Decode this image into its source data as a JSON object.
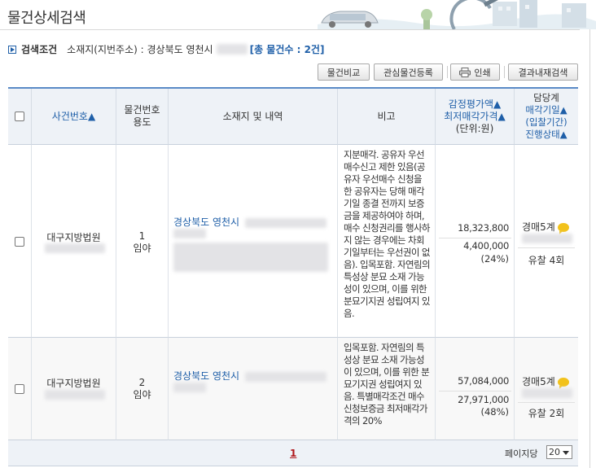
{
  "page": {
    "title": "물건상세검색"
  },
  "condition": {
    "label": "검색조건",
    "location": "소재지(지번주소) : 경상북도 영천시",
    "total": "[총 물건수 : 2건]"
  },
  "toolbar": {
    "compare": "물건비교",
    "register": "관심물건등록",
    "print": "인쇄",
    "search_in_results": "결과내재검색"
  },
  "table": {
    "headers": {
      "case_no": "사건번호",
      "item_no": "물건번호",
      "usage": "용도",
      "location": "소재지 및 내역",
      "note": "비고",
      "appraisal": "감정평가액",
      "min_price": "최저매각가격",
      "unit": "(단위:원)",
      "dept": "담당계",
      "sale_date": "매각기일",
      "period": "(입찰기간)",
      "status": "진행상태"
    },
    "sort_arrow": "▲",
    "rows": [
      {
        "court": "대구지방법원",
        "item_no": "1",
        "usage": "임야",
        "address": "경상북도 영천시",
        "note": "지분매각. 공유자 우선매수신고 제한 있음(공유자 우선매수 신청을 한 공유자는 당해 매각기일 종결 전까지 보증금을 제공하여야 하며, 매수 신청권리를 행사하지 않는 경우에는 차회 기일부터는 우선권이 없음). 입목포함. 자연림의 특성상 분묘 소재 가능성이 있으며, 이를 위한 분묘기지권 성립여지 있음.",
        "appraisal": "18,323,800",
        "min_price": "4,400,000",
        "min_pct": "(24%)",
        "dept": "경매5계",
        "status": "유찰 4회"
      },
      {
        "court": "대구지방법원",
        "item_no": "2",
        "usage": "임야",
        "address": "경상북도 영천시",
        "note": "입목포함. 자연림의 특성상 분묘 소재 가능성이 있으며, 이를 위한 분묘기지권 성립여지 있음. 특별매각조건 매수신청보증금 최저매각가격의 20%",
        "appraisal": "57,084,000",
        "min_price": "27,971,000",
        "min_pct": "(48%)",
        "dept": "경매5계",
        "status": "유찰 2회"
      }
    ]
  },
  "pagination": {
    "current_page": "1",
    "per_page_label": "페이지당",
    "per_page_value": "20"
  },
  "colors": {
    "accent_blue": "#1f5fa8",
    "header_bg": "#eef2f7",
    "page_red": "#b0181d",
    "bubble_yellow": "#f2c21b"
  }
}
